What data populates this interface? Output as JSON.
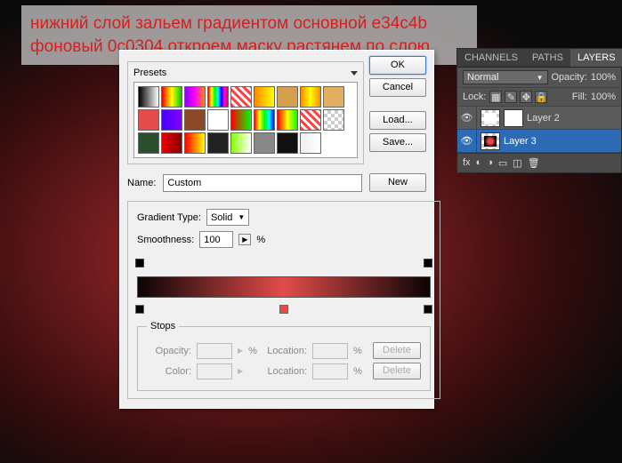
{
  "instruction": "нижний слой зальем градиентом основной e34c4b фоновый 0c0304.откроем маску растянем по слою.",
  "dialog": {
    "presets_label": "Presets",
    "ok": "OK",
    "cancel": "Cancel",
    "load": "Load...",
    "save": "Save...",
    "name_label": "Name:",
    "name_value": "Custom",
    "new": "New",
    "gradient_type_label": "Gradient Type:",
    "gradient_type_value": "Solid",
    "smoothness_label": "Smoothness:",
    "smoothness_value": "100",
    "percent": "%",
    "stops_label": "Stops",
    "opacity_label": "Opacity:",
    "location_label": "Location:",
    "color_label": "Color:",
    "delete": "Delete"
  },
  "panel": {
    "tabs": {
      "channels": "CHANNELS",
      "paths": "PATHS",
      "layers": "LAYERS"
    },
    "blend_mode": "Normal",
    "opacity_label": "Opacity:",
    "opacity_value": "100%",
    "lock_label": "Lock:",
    "fill_label": "Fill:",
    "fill_value": "100%",
    "layers": [
      {
        "name": "Layer 2",
        "active": false
      },
      {
        "name": "Layer 3",
        "active": true
      }
    ]
  },
  "swatches": [
    "linear-gradient(90deg,#000,#fff)",
    "linear-gradient(90deg,#e00,#ff0,#0c0)",
    "linear-gradient(90deg,#80f,#f0f,#f80)",
    "linear-gradient(90deg,#f00,#ff0,#0f0,#0ff,#00f,#f0f,#f00)",
    "repeating-linear-gradient(45deg,#f44,#f44 3px,#fff 3px,#fff 6px)",
    "linear-gradient(90deg,#f80,#ff0)",
    "#d4a050",
    "linear-gradient(90deg,#f80,#ff0,#f80)",
    "#e0b060",
    "#e34c4b",
    "linear-gradient(90deg,#40f,#80f)",
    "#8a4a2a",
    "#fff",
    "linear-gradient(90deg,#f00,#0f0)",
    "linear-gradient(90deg,#f00,#ff0,#0f0,#0ff,#00f)",
    "linear-gradient(90deg,#f00,#ff0,#0f0)",
    "repeating-linear-gradient(45deg,#f44,#f44 3px,#fff 3px,#fff 6px)",
    "checker",
    "#2a5030",
    "linear-gradient(90deg,#e00,#800)",
    "linear-gradient(90deg,#f00,#ff0)",
    "#222",
    "linear-gradient(90deg,#8f0,#fff)",
    "#888",
    "#111",
    "linear-gradient(90deg,#eee,#fff)"
  ]
}
